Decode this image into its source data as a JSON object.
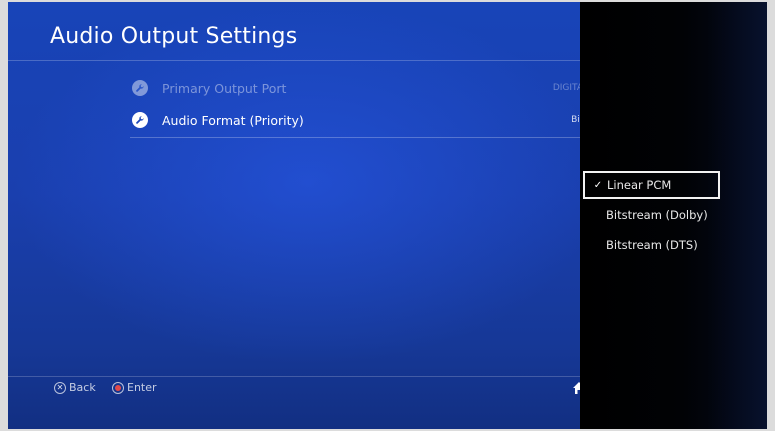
{
  "screen": {
    "title": "Audio Output Settings"
  },
  "settings": [
    {
      "label": "Primary Output Port",
      "value": "DIGITAL",
      "enabled": false,
      "icon": "wrench-icon"
    },
    {
      "label": "Audio Format (Priority)",
      "value": "Bits",
      "enabled": true,
      "icon": "wrench-icon"
    }
  ],
  "hints": {
    "back": "Back",
    "enter": "Enter"
  },
  "dropdown": {
    "options": [
      {
        "label": "Linear PCM",
        "selected": true
      },
      {
        "label": "Bitstream (Dolby)",
        "selected": false
      },
      {
        "label": "Bitstream (DTS)",
        "selected": false
      }
    ],
    "check_glyph": "✓"
  },
  "colors": {
    "background": "#1a3fae",
    "overlay": "#000000",
    "focus_border": "#f2f2f2",
    "enter_button": "#e24a4a"
  }
}
